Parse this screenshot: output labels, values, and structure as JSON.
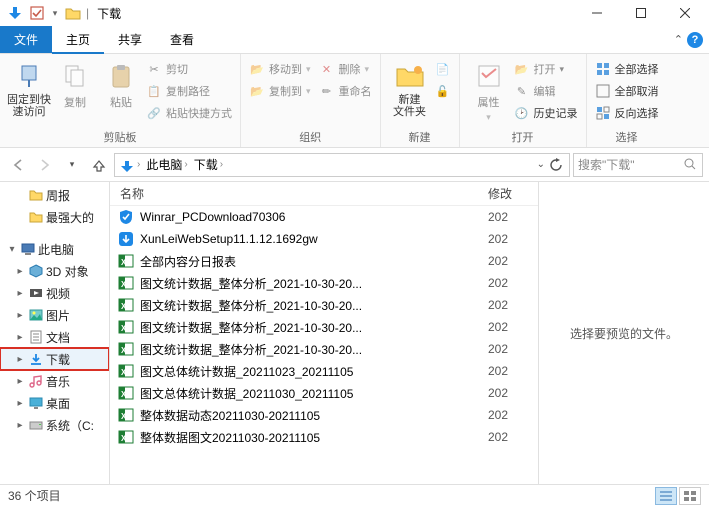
{
  "window": {
    "title": "下载"
  },
  "tabs": {
    "file": "文件",
    "home": "主页",
    "share": "共享",
    "view": "查看"
  },
  "ribbon": {
    "clipboard": {
      "pin": "固定到快\n速访问",
      "copy": "复制",
      "paste": "粘贴",
      "cut": "剪切",
      "copypath": "复制路径",
      "pasteshortcut": "粘贴快捷方式",
      "label": "剪贴板"
    },
    "organize": {
      "moveto": "移动到",
      "copyto": "复制到",
      "delete": "删除",
      "rename": "重命名",
      "label": "组织"
    },
    "new": {
      "folder": "新建\n文件夹",
      "label": "新建"
    },
    "open": {
      "properties": "属性",
      "open": "打开",
      "edit": "编辑",
      "history": "历史记录",
      "label": "打开"
    },
    "select": {
      "selectall": "全部选择",
      "selectnone": "全部取消",
      "invert": "反向选择",
      "label": "选择"
    }
  },
  "breadcrumbs": [
    "此电脑",
    "下载"
  ],
  "search_placeholder": "搜索\"下载\"",
  "navtree": [
    {
      "level": 2,
      "icon": "folder",
      "label": "周报",
      "twisty": ""
    },
    {
      "level": 2,
      "icon": "folder",
      "label": "最强大的",
      "twisty": ""
    },
    {
      "level": 1,
      "icon": "pc",
      "label": "此电脑",
      "twisty": "▾"
    },
    {
      "level": 2,
      "icon": "cube",
      "label": "3D 对象",
      "twisty": "▸"
    },
    {
      "level": 2,
      "icon": "video",
      "label": "视频",
      "twisty": "▸"
    },
    {
      "level": 2,
      "icon": "picture",
      "label": "图片",
      "twisty": "▸"
    },
    {
      "level": 2,
      "icon": "doc",
      "label": "文档",
      "twisty": "▸"
    },
    {
      "level": 2,
      "icon": "download",
      "label": "下载",
      "twisty": "▸",
      "highlight": true
    },
    {
      "level": 2,
      "icon": "music",
      "label": "音乐",
      "twisty": "▸"
    },
    {
      "level": 2,
      "icon": "desktop",
      "label": "桌面",
      "twisty": "▸"
    },
    {
      "level": 2,
      "icon": "disk",
      "label": "系统（C:",
      "twisty": "▸"
    }
  ],
  "columns": {
    "name": "名称",
    "modified": "修改"
  },
  "files": [
    {
      "icon": "shield",
      "name": "Winrar_PCDownload70306",
      "mod": "202"
    },
    {
      "icon": "xl",
      "name": "XunLeiWebSetup11.1.12.1692gw",
      "mod": "202"
    },
    {
      "icon": "excel",
      "name": "全部内容分日报表",
      "mod": "202"
    },
    {
      "icon": "excel",
      "name": "图文统计数据_整体分析_2021-10-30-20...",
      "mod": "202"
    },
    {
      "icon": "excel",
      "name": "图文统计数据_整体分析_2021-10-30-20...",
      "mod": "202"
    },
    {
      "icon": "excel",
      "name": "图文统计数据_整体分析_2021-10-30-20...",
      "mod": "202"
    },
    {
      "icon": "excel",
      "name": "图文统计数据_整体分析_2021-10-30-20...",
      "mod": "202"
    },
    {
      "icon": "excel",
      "name": "图文总体统计数据_20211023_20211105",
      "mod": "202"
    },
    {
      "icon": "excel",
      "name": "图文总体统计数据_20211030_20211105",
      "mod": "202"
    },
    {
      "icon": "excel",
      "name": "整体数据动态20211030-20211105",
      "mod": "202"
    },
    {
      "icon": "excel",
      "name": "整体数据图文20211030-20211105",
      "mod": "202"
    }
  ],
  "preview_msg": "选择要预览的文件。",
  "status": "36 个项目"
}
